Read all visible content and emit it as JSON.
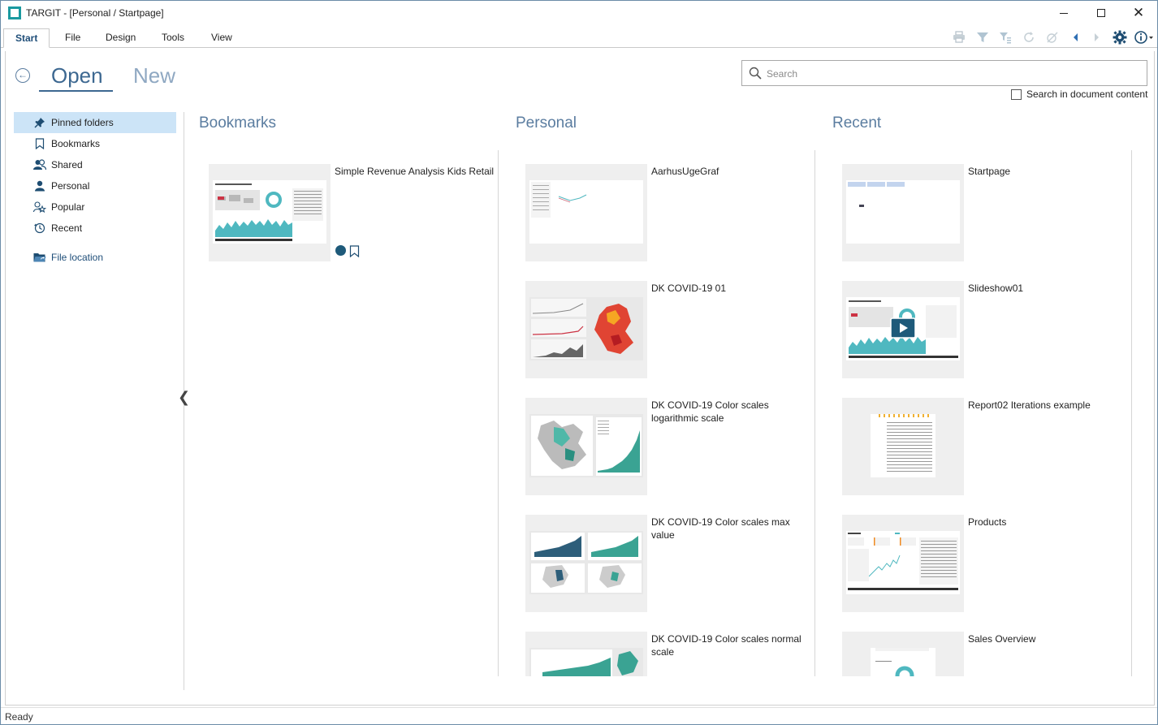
{
  "window": {
    "title": "TARGIT - [Personal / Startpage]"
  },
  "ribbon": {
    "tabs": [
      {
        "label": "Start",
        "active": true
      },
      {
        "label": "File",
        "active": false
      },
      {
        "label": "Design",
        "active": false
      },
      {
        "label": "Tools",
        "active": false
      },
      {
        "label": "View",
        "active": false
      }
    ],
    "tool_icons": [
      "print-icon",
      "filter-icon",
      "filter-list-icon",
      "refresh-icon",
      "no-criteria-icon",
      "back-arrow-icon",
      "forward-arrow-icon",
      "settings-gear-icon",
      "info-icon"
    ]
  },
  "start": {
    "mode_open": "Open",
    "mode_new": "New",
    "search_placeholder": "Search",
    "search_in_content_label": "Search in document content"
  },
  "sidebar": {
    "items": [
      {
        "label": "Pinned folders",
        "icon": "pin-icon",
        "active": true
      },
      {
        "label": "Bookmarks",
        "icon": "bookmark-icon",
        "active": false
      },
      {
        "label": "Shared",
        "icon": "shared-users-icon",
        "active": false
      },
      {
        "label": "Personal",
        "icon": "person-icon",
        "active": false
      },
      {
        "label": "Popular",
        "icon": "popular-icon",
        "active": false
      },
      {
        "label": "Recent",
        "icon": "recent-clock-icon",
        "active": false
      }
    ],
    "file_location": "File location"
  },
  "columns": {
    "bookmarks": {
      "title": "Bookmarks",
      "items": [
        {
          "title": "Simple Revenue Analysis Kids Retail"
        }
      ]
    },
    "personal": {
      "title": "Personal",
      "items": [
        {
          "title": "AarhusUgeGraf"
        },
        {
          "title": "DK COVID-19 01"
        },
        {
          "title": "DK COVID-19 Color scales logarithmic scale"
        },
        {
          "title": "DK COVID-19 Color scales max value"
        },
        {
          "title": "DK COVID-19 Color scales normal scale"
        }
      ]
    },
    "recent": {
      "title": "Recent",
      "items": [
        {
          "title": "Startpage"
        },
        {
          "title": "Slideshow01"
        },
        {
          "title": "Report02 Iterations example"
        },
        {
          "title": "Products"
        },
        {
          "title": "Sales Overview"
        }
      ]
    }
  },
  "status": {
    "text": "Ready"
  },
  "colors": {
    "accent": "#3d6891",
    "teal": "#1a9aa0",
    "selection": "#cce4f7"
  }
}
